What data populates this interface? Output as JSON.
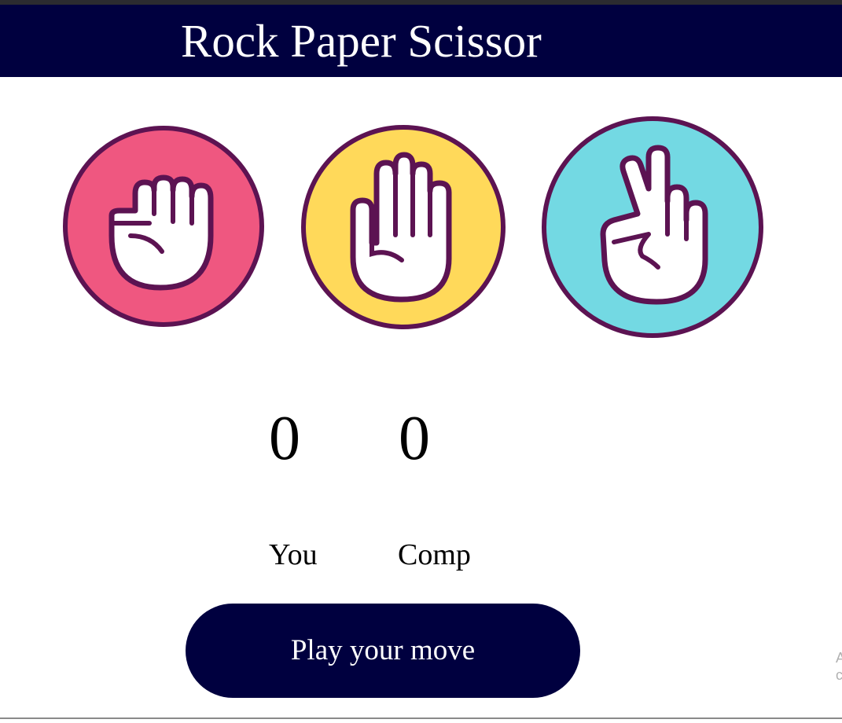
{
  "app": {
    "title": "Rock Paper Scissor"
  },
  "choices": [
    {
      "id": "rock",
      "name": "rock",
      "icon": "fist-hand-icon",
      "color": "#ef5780"
    },
    {
      "id": "paper",
      "name": "paper",
      "icon": "open-hand-icon",
      "color": "#ffd95a"
    },
    {
      "id": "scissors",
      "name": "scissors",
      "icon": "peace-hand-icon",
      "color": "#73d9e3"
    }
  ],
  "scoreboard": {
    "user_score": "0",
    "comp_score": "0",
    "user_label": "You",
    "comp_label": "Comp"
  },
  "message": {
    "text": "Play your move"
  },
  "colors": {
    "header_bg": "#00003f",
    "outline": "#5c1352",
    "message_bg": "#00003f"
  }
}
